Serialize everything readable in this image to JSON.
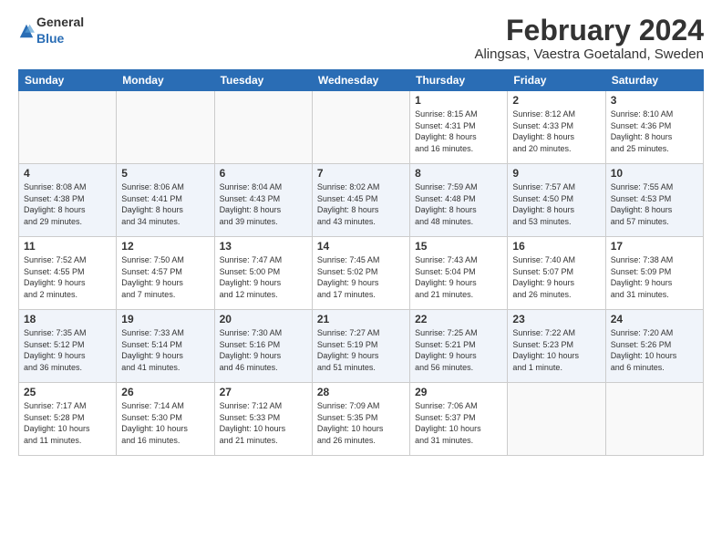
{
  "logo": {
    "general": "General",
    "blue": "Blue"
  },
  "title": "February 2024",
  "subtitle": "Alingsas, Vaestra Goetaland, Sweden",
  "days_of_week": [
    "Sunday",
    "Monday",
    "Tuesday",
    "Wednesday",
    "Thursday",
    "Friday",
    "Saturday"
  ],
  "weeks": [
    [
      {
        "day": "",
        "info": ""
      },
      {
        "day": "",
        "info": ""
      },
      {
        "day": "",
        "info": ""
      },
      {
        "day": "",
        "info": ""
      },
      {
        "day": "1",
        "info": "Sunrise: 8:15 AM\nSunset: 4:31 PM\nDaylight: 8 hours\nand 16 minutes."
      },
      {
        "day": "2",
        "info": "Sunrise: 8:12 AM\nSunset: 4:33 PM\nDaylight: 8 hours\nand 20 minutes."
      },
      {
        "day": "3",
        "info": "Sunrise: 8:10 AM\nSunset: 4:36 PM\nDaylight: 8 hours\nand 25 minutes."
      }
    ],
    [
      {
        "day": "4",
        "info": "Sunrise: 8:08 AM\nSunset: 4:38 PM\nDaylight: 8 hours\nand 29 minutes."
      },
      {
        "day": "5",
        "info": "Sunrise: 8:06 AM\nSunset: 4:41 PM\nDaylight: 8 hours\nand 34 minutes."
      },
      {
        "day": "6",
        "info": "Sunrise: 8:04 AM\nSunset: 4:43 PM\nDaylight: 8 hours\nand 39 minutes."
      },
      {
        "day": "7",
        "info": "Sunrise: 8:02 AM\nSunset: 4:45 PM\nDaylight: 8 hours\nand 43 minutes."
      },
      {
        "day": "8",
        "info": "Sunrise: 7:59 AM\nSunset: 4:48 PM\nDaylight: 8 hours\nand 48 minutes."
      },
      {
        "day": "9",
        "info": "Sunrise: 7:57 AM\nSunset: 4:50 PM\nDaylight: 8 hours\nand 53 minutes."
      },
      {
        "day": "10",
        "info": "Sunrise: 7:55 AM\nSunset: 4:53 PM\nDaylight: 8 hours\nand 57 minutes."
      }
    ],
    [
      {
        "day": "11",
        "info": "Sunrise: 7:52 AM\nSunset: 4:55 PM\nDaylight: 9 hours\nand 2 minutes."
      },
      {
        "day": "12",
        "info": "Sunrise: 7:50 AM\nSunset: 4:57 PM\nDaylight: 9 hours\nand 7 minutes."
      },
      {
        "day": "13",
        "info": "Sunrise: 7:47 AM\nSunset: 5:00 PM\nDaylight: 9 hours\nand 12 minutes."
      },
      {
        "day": "14",
        "info": "Sunrise: 7:45 AM\nSunset: 5:02 PM\nDaylight: 9 hours\nand 17 minutes."
      },
      {
        "day": "15",
        "info": "Sunrise: 7:43 AM\nSunset: 5:04 PM\nDaylight: 9 hours\nand 21 minutes."
      },
      {
        "day": "16",
        "info": "Sunrise: 7:40 AM\nSunset: 5:07 PM\nDaylight: 9 hours\nand 26 minutes."
      },
      {
        "day": "17",
        "info": "Sunrise: 7:38 AM\nSunset: 5:09 PM\nDaylight: 9 hours\nand 31 minutes."
      }
    ],
    [
      {
        "day": "18",
        "info": "Sunrise: 7:35 AM\nSunset: 5:12 PM\nDaylight: 9 hours\nand 36 minutes."
      },
      {
        "day": "19",
        "info": "Sunrise: 7:33 AM\nSunset: 5:14 PM\nDaylight: 9 hours\nand 41 minutes."
      },
      {
        "day": "20",
        "info": "Sunrise: 7:30 AM\nSunset: 5:16 PM\nDaylight: 9 hours\nand 46 minutes."
      },
      {
        "day": "21",
        "info": "Sunrise: 7:27 AM\nSunset: 5:19 PM\nDaylight: 9 hours\nand 51 minutes."
      },
      {
        "day": "22",
        "info": "Sunrise: 7:25 AM\nSunset: 5:21 PM\nDaylight: 9 hours\nand 56 minutes."
      },
      {
        "day": "23",
        "info": "Sunrise: 7:22 AM\nSunset: 5:23 PM\nDaylight: 10 hours\nand 1 minute."
      },
      {
        "day": "24",
        "info": "Sunrise: 7:20 AM\nSunset: 5:26 PM\nDaylight: 10 hours\nand 6 minutes."
      }
    ],
    [
      {
        "day": "25",
        "info": "Sunrise: 7:17 AM\nSunset: 5:28 PM\nDaylight: 10 hours\nand 11 minutes."
      },
      {
        "day": "26",
        "info": "Sunrise: 7:14 AM\nSunset: 5:30 PM\nDaylight: 10 hours\nand 16 minutes."
      },
      {
        "day": "27",
        "info": "Sunrise: 7:12 AM\nSunset: 5:33 PM\nDaylight: 10 hours\nand 21 minutes."
      },
      {
        "day": "28",
        "info": "Sunrise: 7:09 AM\nSunset: 5:35 PM\nDaylight: 10 hours\nand 26 minutes."
      },
      {
        "day": "29",
        "info": "Sunrise: 7:06 AM\nSunset: 5:37 PM\nDaylight: 10 hours\nand 31 minutes."
      },
      {
        "day": "",
        "info": ""
      },
      {
        "day": "",
        "info": ""
      }
    ]
  ]
}
